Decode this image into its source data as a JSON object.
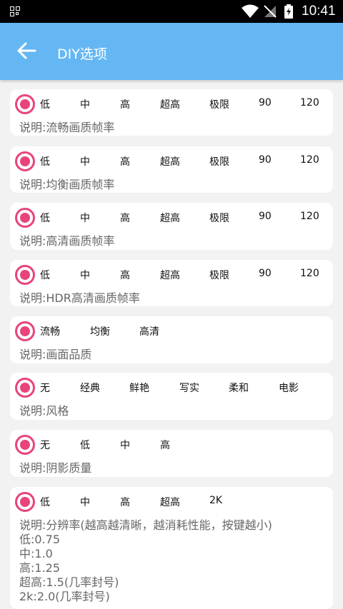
{
  "status_bar": {
    "time": "10:41",
    "icons": [
      "notification-icon",
      "wifi-icon",
      "no-sim-icon",
      "battery-icon"
    ]
  },
  "app_bar": {
    "title": "DIY选项",
    "back_icon": "arrow-left-icon"
  },
  "accent_color": "#e8447b",
  "header_color": "#65b7f3",
  "cards": [
    {
      "options": [
        "低",
        "中",
        "高",
        "超高",
        "极限",
        "90",
        "120"
      ],
      "description": "说明:流畅画质帧率"
    },
    {
      "options": [
        "低",
        "中",
        "高",
        "超高",
        "极限",
        "90",
        "120"
      ],
      "description": "说明:均衡画质帧率"
    },
    {
      "options": [
        "低",
        "中",
        "高",
        "超高",
        "极限",
        "90",
        "120"
      ],
      "description": "说明:高清画质帧率"
    },
    {
      "options": [
        "低",
        "中",
        "高",
        "超高",
        "极限",
        "90",
        "120"
      ],
      "description": "说明:HDR高清画质帧率"
    },
    {
      "options": [
        "流畅",
        "均衡",
        "高清"
      ],
      "description": "说明:画面品质"
    },
    {
      "options": [
        "无",
        "经典",
        "鲜艳",
        "写实",
        "柔和",
        "电影"
      ],
      "description": "说明:风格"
    },
    {
      "options": [
        "无",
        "低",
        "中",
        "高"
      ],
      "description": "说明:阴影质量"
    },
    {
      "options": [
        "低",
        "中",
        "高",
        "超高",
        "2K"
      ],
      "description": "说明:分辨率(越高越清晰，越消耗性能，按键越小)\n低:0.75\n中:1.0\n高:1.25\n超高:1.5(几率封号)\n2k:2.0(几率封号)"
    }
  ]
}
